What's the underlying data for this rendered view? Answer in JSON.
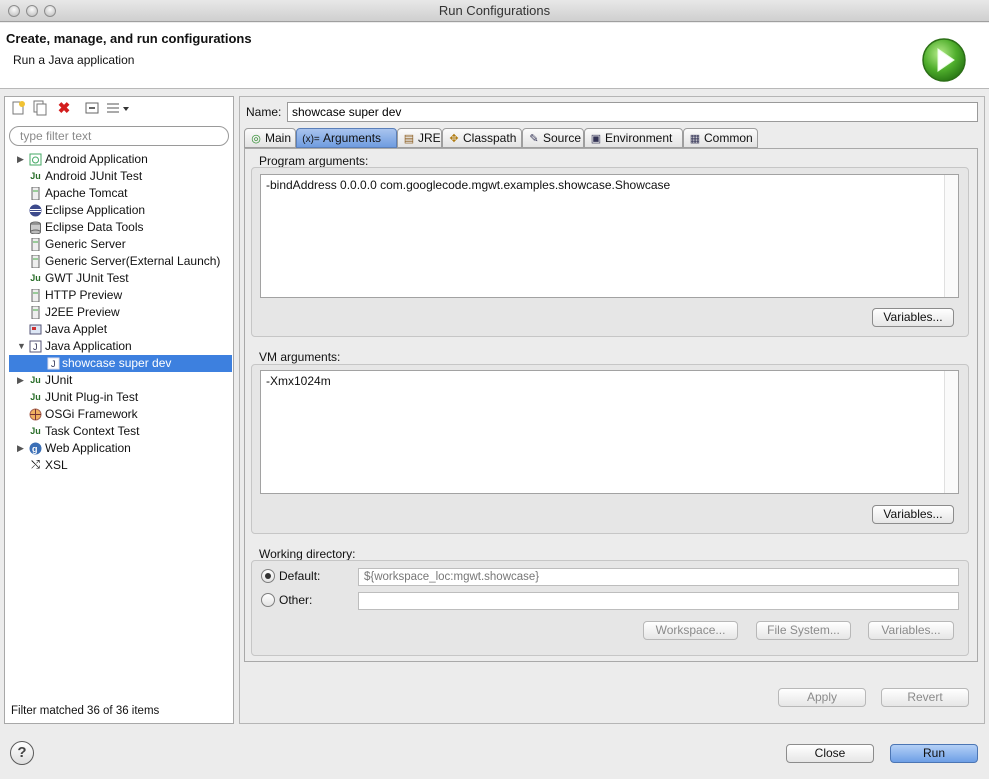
{
  "window": {
    "title": "Run Configurations"
  },
  "header": {
    "title": "Create, manage, and run configurations",
    "subtitle": "Run a Java application"
  },
  "left": {
    "filter_placeholder": "type filter text",
    "tree": [
      {
        "label": "Android Application",
        "icon": "android-app-icon",
        "expandable": true,
        "expanded": false
      },
      {
        "label": "Android JUnit Test",
        "icon": "junit-icon",
        "expandable": false
      },
      {
        "label": "Apache Tomcat",
        "icon": "server-icon",
        "expandable": false
      },
      {
        "label": "Eclipse Application",
        "icon": "eclipse-icon",
        "expandable": false
      },
      {
        "label": "Eclipse Data Tools",
        "icon": "database-icon",
        "expandable": false
      },
      {
        "label": "Generic Server",
        "icon": "server-icon",
        "expandable": false
      },
      {
        "label": "Generic Server(External Launch)",
        "icon": "server-icon",
        "expandable": false
      },
      {
        "label": "GWT JUnit Test",
        "icon": "junit-icon",
        "expandable": false
      },
      {
        "label": "HTTP Preview",
        "icon": "server-icon",
        "expandable": false
      },
      {
        "label": "J2EE Preview",
        "icon": "server-icon",
        "expandable": false
      },
      {
        "label": "Java Applet",
        "icon": "applet-icon",
        "expandable": false
      },
      {
        "label": "Java Application",
        "icon": "java-app-icon",
        "expandable": true,
        "expanded": true
      },
      {
        "label": "showcase super dev",
        "icon": "java-app-icon",
        "child": true,
        "selected": true
      },
      {
        "label": "JUnit",
        "icon": "junit-icon",
        "expandable": true,
        "expanded": false
      },
      {
        "label": "JUnit Plug-in Test",
        "icon": "junit-icon",
        "expandable": false
      },
      {
        "label": "OSGi Framework",
        "icon": "osgi-icon",
        "expandable": false
      },
      {
        "label": "Task Context Test",
        "icon": "junit-icon",
        "expandable": false
      },
      {
        "label": "Web Application",
        "icon": "globe-icon",
        "expandable": true,
        "expanded": false
      },
      {
        "label": "XSL",
        "icon": "xsl-icon",
        "expandable": false
      }
    ],
    "status": "Filter matched 36 of 36 items"
  },
  "right": {
    "name_label": "Name:",
    "name_value": "showcase super dev",
    "tabs": [
      {
        "label": "Main",
        "icon": "main-tab-icon",
        "glyph": "◎",
        "active": false
      },
      {
        "label": "Arguments",
        "icon": "arguments-tab-icon",
        "glyph": "(x)=",
        "active": true
      },
      {
        "label": "JRE",
        "icon": "jre-tab-icon",
        "glyph": "▤",
        "active": false
      },
      {
        "label": "Classpath",
        "icon": "classpath-tab-icon",
        "glyph": "✥",
        "active": false
      },
      {
        "label": "Source",
        "icon": "source-tab-icon",
        "glyph": "✎",
        "active": false
      },
      {
        "label": "Environment",
        "icon": "environment-tab-icon",
        "glyph": "▣",
        "active": false
      },
      {
        "label": "Common",
        "icon": "common-tab-icon",
        "glyph": "▦",
        "active": false
      }
    ],
    "program_args_label": "Program arguments:",
    "program_args_value": "-bindAddress 0.0.0.0 com.googlecode.mgwt.examples.showcase.Showcase",
    "vm_args_label": "VM arguments:",
    "vm_args_value": "-Xmx1024m",
    "variables_label": "Variables...",
    "working_dir_label": "Working directory:",
    "default_label": "Default:",
    "default_value": "${workspace_loc:mgwt.showcase}",
    "other_label": "Other:",
    "other_value": "",
    "workspace_button": "Workspace...",
    "filesystem_button": "File System...",
    "apply_button": "Apply",
    "revert_button": "Revert"
  },
  "footer": {
    "help": "?",
    "close_button": "Close",
    "run_button": "Run"
  }
}
